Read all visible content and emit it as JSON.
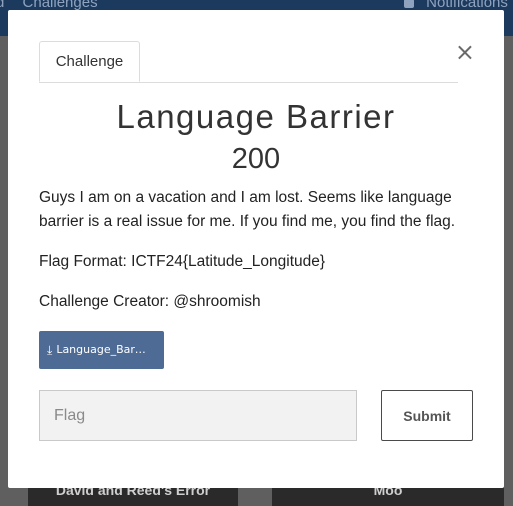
{
  "background": {
    "nav_left_truncated": "d",
    "nav_challenges": "Challenges",
    "nav_notifications": "Notifications",
    "card_left": "David and Reed's Error",
    "card_right": "Moo"
  },
  "modal": {
    "close_symbol": "×",
    "tab_label": "Challenge",
    "title": "Language Barrier",
    "value": "200",
    "description": [
      "Guys I am on a vacation and I am lost. Seems like language barrier is a real issue for me. If you find me, you find the flag.",
      "Flag Format: ICTF24{Latitude_Longitude}",
      "Challenge Creator: @shroomish"
    ],
    "download_file": "Language_Barrier",
    "flag_placeholder": "Flag",
    "submit_label": "Submit"
  },
  "colors": {
    "download_bg": "#4d6b95",
    "overlay": "#5f5f5f"
  }
}
